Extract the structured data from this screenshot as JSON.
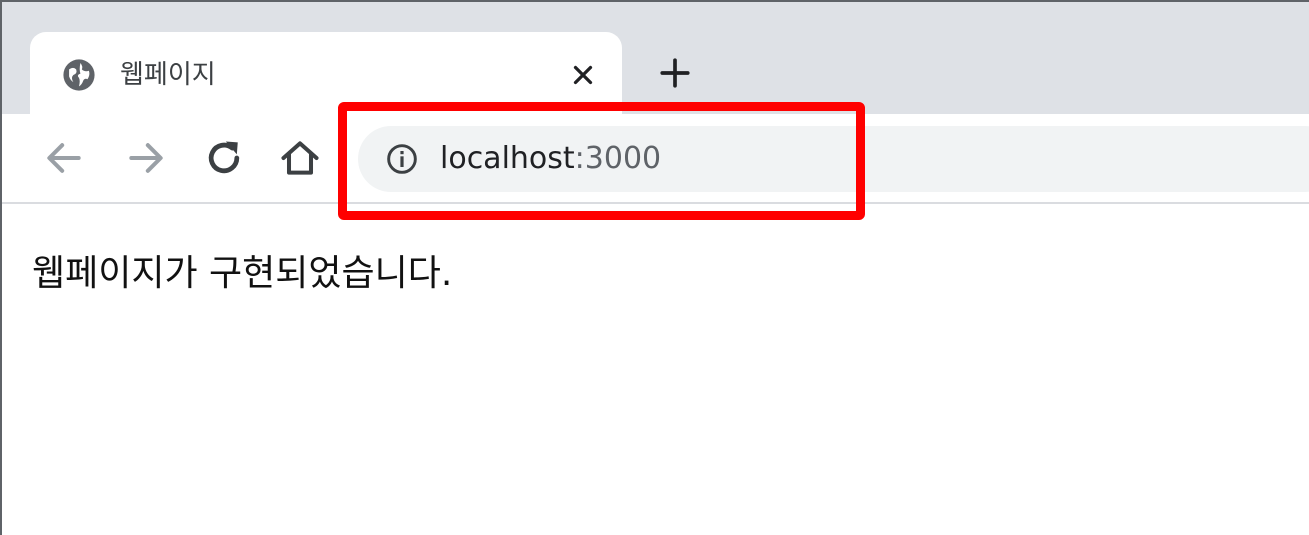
{
  "tab": {
    "title": "웹페이지",
    "favicon": "globe-icon",
    "close_icon": "close-icon"
  },
  "new_tab_icon": "plus-icon",
  "toolbar": {
    "back_icon": "back-arrow-icon",
    "forward_icon": "forward-arrow-icon",
    "reload_icon": "reload-icon",
    "home_icon": "home-icon"
  },
  "omnibox": {
    "site_info_icon": "info-icon",
    "host": "localhost",
    "port": ":3000"
  },
  "highlight": {
    "color": "#ff0000"
  },
  "page": {
    "body_text": "웹페이지가 구현되었습니다."
  },
  "colors": {
    "tabstrip": "#dee1e6",
    "omnibox": "#f1f3f4",
    "icon_gray": "#5f6368",
    "icon_disabled": "#9aa0a6"
  }
}
